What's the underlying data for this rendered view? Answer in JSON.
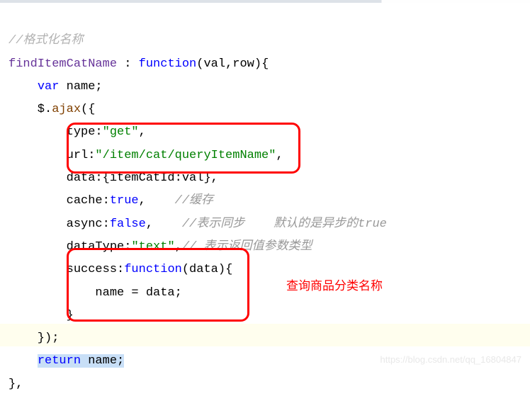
{
  "code": {
    "comment_top": "//格式化名称",
    "fn_label": "findItemCatName",
    "colon": " : ",
    "kw_function": "function",
    "fn_args": "(val,row){",
    "indent1_var": "    ",
    "kw_var": "var",
    "var_name": " name;",
    "indent1_ajax": "    $.",
    "ajax_call": "ajax",
    "ajax_open": "({",
    "line_type_pre": "        type:",
    "str_get": "\"get\"",
    "comma": ",",
    "line_url_pre": "        url:",
    "str_url": "\"/item/cat/queryItemName\"",
    "line_data": "        data:{itemCatId:val},",
    "line_cache_pre": "        cache:",
    "kw_true": "true",
    "cmt_cache": "//缓存",
    "line_async_pre": "        async:",
    "kw_false": "false",
    "cmt_async": "//表示同步    默认的是异步的true",
    "line_dt_pre": "        dataType:",
    "str_text": "\"text\"",
    "cmt_dt": "// 表示返回值参数类型",
    "line_succ_pre": "        success:",
    "succ_args": "(data){",
    "line_name_assign": "            name = data;",
    "line_brace": "        }",
    "line_close": "    });",
    "ret_indent": "    ",
    "kw_return": "return",
    "ret_tail": " name;",
    "close": "},"
  },
  "annotation": "查询商品分类名称",
  "watermark": "https://blog.csdn.net/qq_16804847"
}
